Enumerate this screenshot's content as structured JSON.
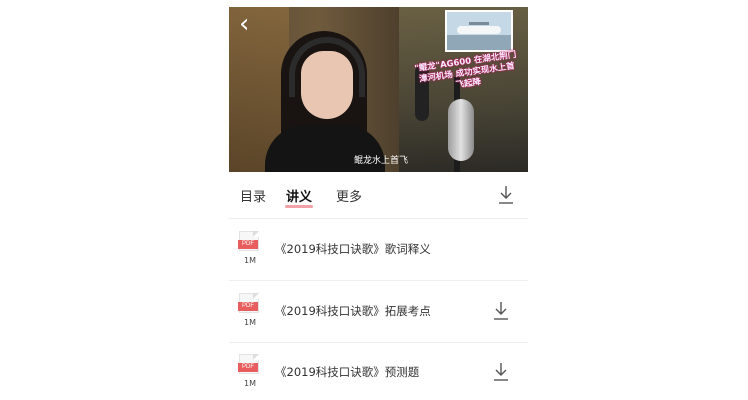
{
  "video": {
    "overlay_caption": "\"鲲龙\"AG600 在湖北荆门漳河机场 成功实现水上首飞起降",
    "subtitle": "鲲龙水上首飞"
  },
  "tabs": [
    {
      "label": "目录",
      "active": false
    },
    {
      "label": "讲义",
      "active": true
    },
    {
      "label": "更多",
      "active": false
    }
  ],
  "files": [
    {
      "type": "PDF",
      "size": "1M",
      "title": "《2019科技口诀歌》歌词释义",
      "downloadable": false
    },
    {
      "type": "PDF",
      "size": "1M",
      "title": "《2019科技口诀歌》拓展考点",
      "downloadable": true
    },
    {
      "type": "PDF",
      "size": "1M",
      "title": "《2019科技口诀歌》预测题",
      "downloadable": true
    }
  ],
  "icons": {
    "back": "chevron-left-icon",
    "download": "download-icon",
    "file": "pdf-file-icon"
  },
  "colors": {
    "accent_underline": "#f3a1a8",
    "pdf_tag": "#e85d5d"
  }
}
